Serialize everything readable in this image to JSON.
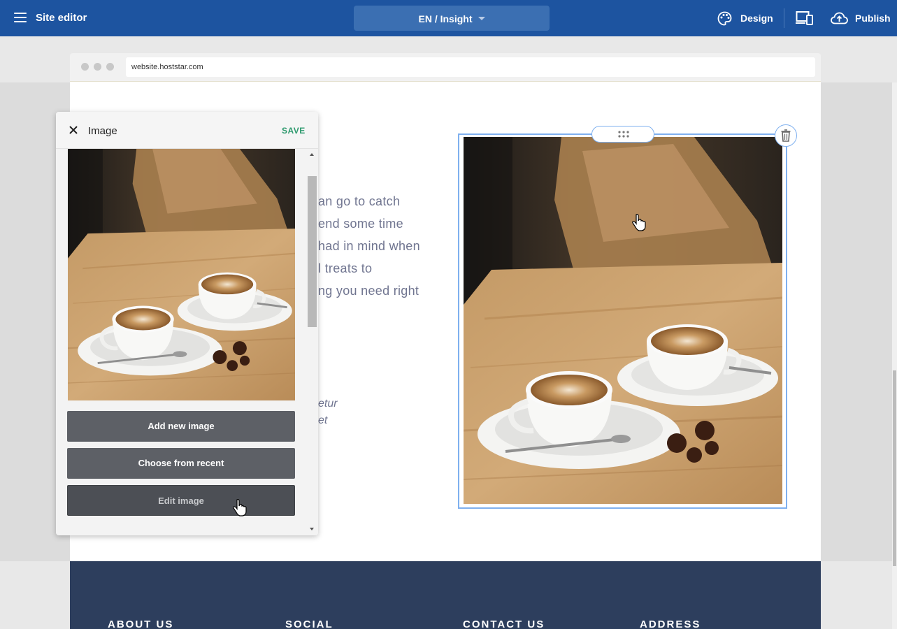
{
  "topbar": {
    "menu_icon": "hamburger-icon",
    "title": "Site editor",
    "language_page": "EN / Insight",
    "design_label": "Design",
    "design_icon": "palette-icon",
    "devices_icon": "devices-icon",
    "publish_label": "Publish",
    "publish_icon": "cloud-upload-icon",
    "color": "#1d54a0"
  },
  "browser": {
    "url": "website.hoststar.com"
  },
  "page": {
    "text_lines": [
      "an go to catch",
      "end some time",
      "had in mind when",
      "l treats to",
      "ng you need right"
    ],
    "italic_lines": [
      "etur",
      "et"
    ]
  },
  "image_panel": {
    "title": "Image",
    "save_label": "SAVE",
    "add_new_label": "Add new image",
    "choose_recent_label": "Choose from recent",
    "edit_label": "Edit image"
  },
  "footer": {
    "columns": [
      "ABOUT US",
      "SOCIAL",
      "CONTACT US",
      "ADDRESS"
    ],
    "color": "#2d3e5d"
  },
  "selection_color": "#7fb0ef"
}
